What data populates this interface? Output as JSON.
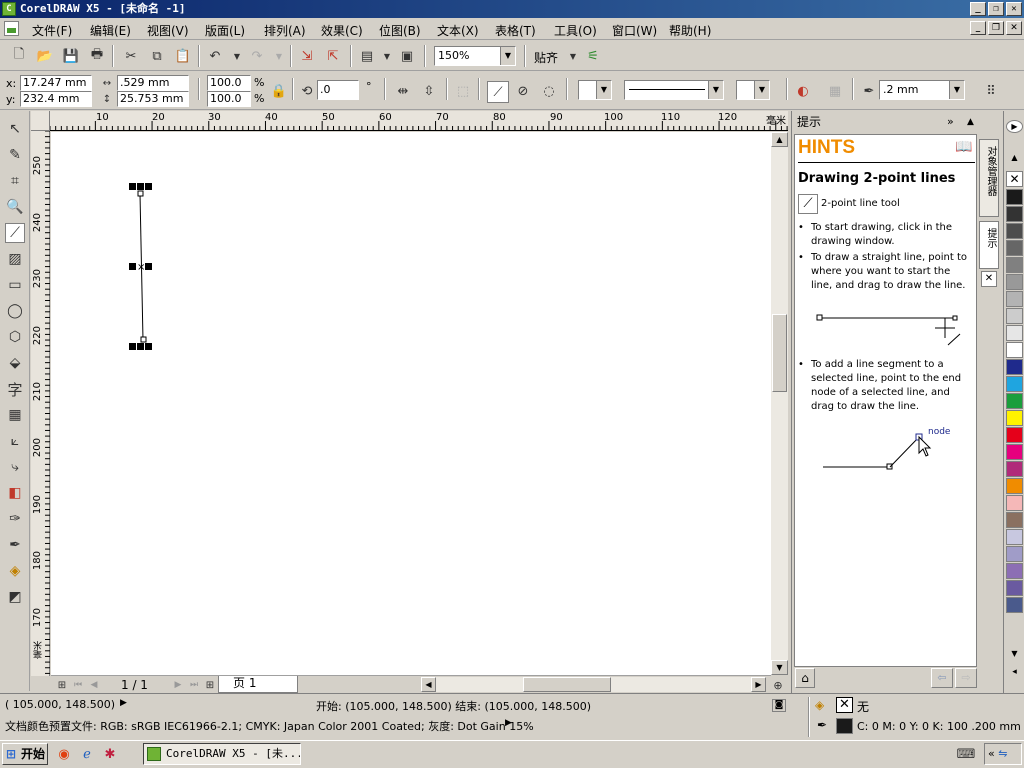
{
  "window": {
    "title": "CorelDRAW X5 - [未命名 -1]",
    "app_icon": "coreldraw-icon"
  },
  "menu": {
    "items": [
      "文件(F)",
      "编辑(E)",
      "视图(V)",
      "版面(L)",
      "排列(A)",
      "效果(C)",
      "位图(B)",
      "文本(X)",
      "表格(T)",
      "工具(O)",
      "窗口(W)",
      "帮助(H)"
    ]
  },
  "standard_toolbar": {
    "zoom_value": "150%",
    "snap_label": "贴齐"
  },
  "property_bar": {
    "x_label": "x:",
    "x_value": "17.247 mm",
    "y_label": "y:",
    "y_value": "232.4 mm",
    "width_value": ".529 mm",
    "height_value": "25.753 mm",
    "scale_x": "100.0",
    "scale_y": "100.0",
    "percent": "%",
    "rotation_value": ".0",
    "degree": "°",
    "outline_width": ".2 mm"
  },
  "rulers": {
    "horizontal_ticks": [
      "10",
      "20",
      "30",
      "40",
      "50",
      "60",
      "70",
      "80",
      "90",
      "100",
      "110",
      "120"
    ],
    "horizontal_unit": "毫米",
    "vertical_ticks": [
      "250",
      "240",
      "230",
      "220",
      "210",
      "200",
      "190",
      "180",
      "170"
    ],
    "vertical_unit": "毫米"
  },
  "page_nav": {
    "page_count": "1 / 1",
    "page_tab": "页 1"
  },
  "hints_panel": {
    "header": "提示",
    "title": "HINTS",
    "heading": "Drawing 2-point lines",
    "tool_name": "2-point line tool",
    "bullets": [
      "To start drawing, click in the drawing window.",
      "To draw a straight line, point to where you want to start the line, and drag to draw the line.",
      "To add a line segment to a selected line, point to the end node of a selected line, and drag to draw the line."
    ],
    "node_label": "node"
  },
  "side_tabs": {
    "object_manager": "对象管理器",
    "hints": "提示"
  },
  "palette": {
    "colors": [
      "#1a1a1a",
      "#333333",
      "#4d4d4d",
      "#666666",
      "#808080",
      "#999999",
      "#b3b3b3",
      "#cccccc",
      "#e6e6e6",
      "#ffffff",
      "#1f2a8c",
      "#1fa5e0",
      "#1a9e3c",
      "#fff200",
      "#e5001a",
      "#e6007e",
      "#b02a7a",
      "#f08c00",
      "#f5b8b8",
      "#8a7060",
      "#c8c8e0",
      "#a09cc8",
      "#8c6eb4",
      "#6a5aa0",
      "#4a5a8c"
    ]
  },
  "status": {
    "cursor": "( 105.000, 148.500)",
    "start_end": "开始: (105.000, 148.500)  结束: (105.000, 148.500)",
    "fill_label": "无",
    "profiles": "文档颜色预置文件: RGB: sRGB IEC61966-2.1; CMYK: Japan Color 2001 Coated; 灰度: Dot Gain 15%",
    "outline_info": "C: 0 M: 0 Y: 0 K: 100  .200 mm"
  },
  "taskbar": {
    "start_label": "开始",
    "task_label": "CorelDRAW X5 - [未..."
  }
}
